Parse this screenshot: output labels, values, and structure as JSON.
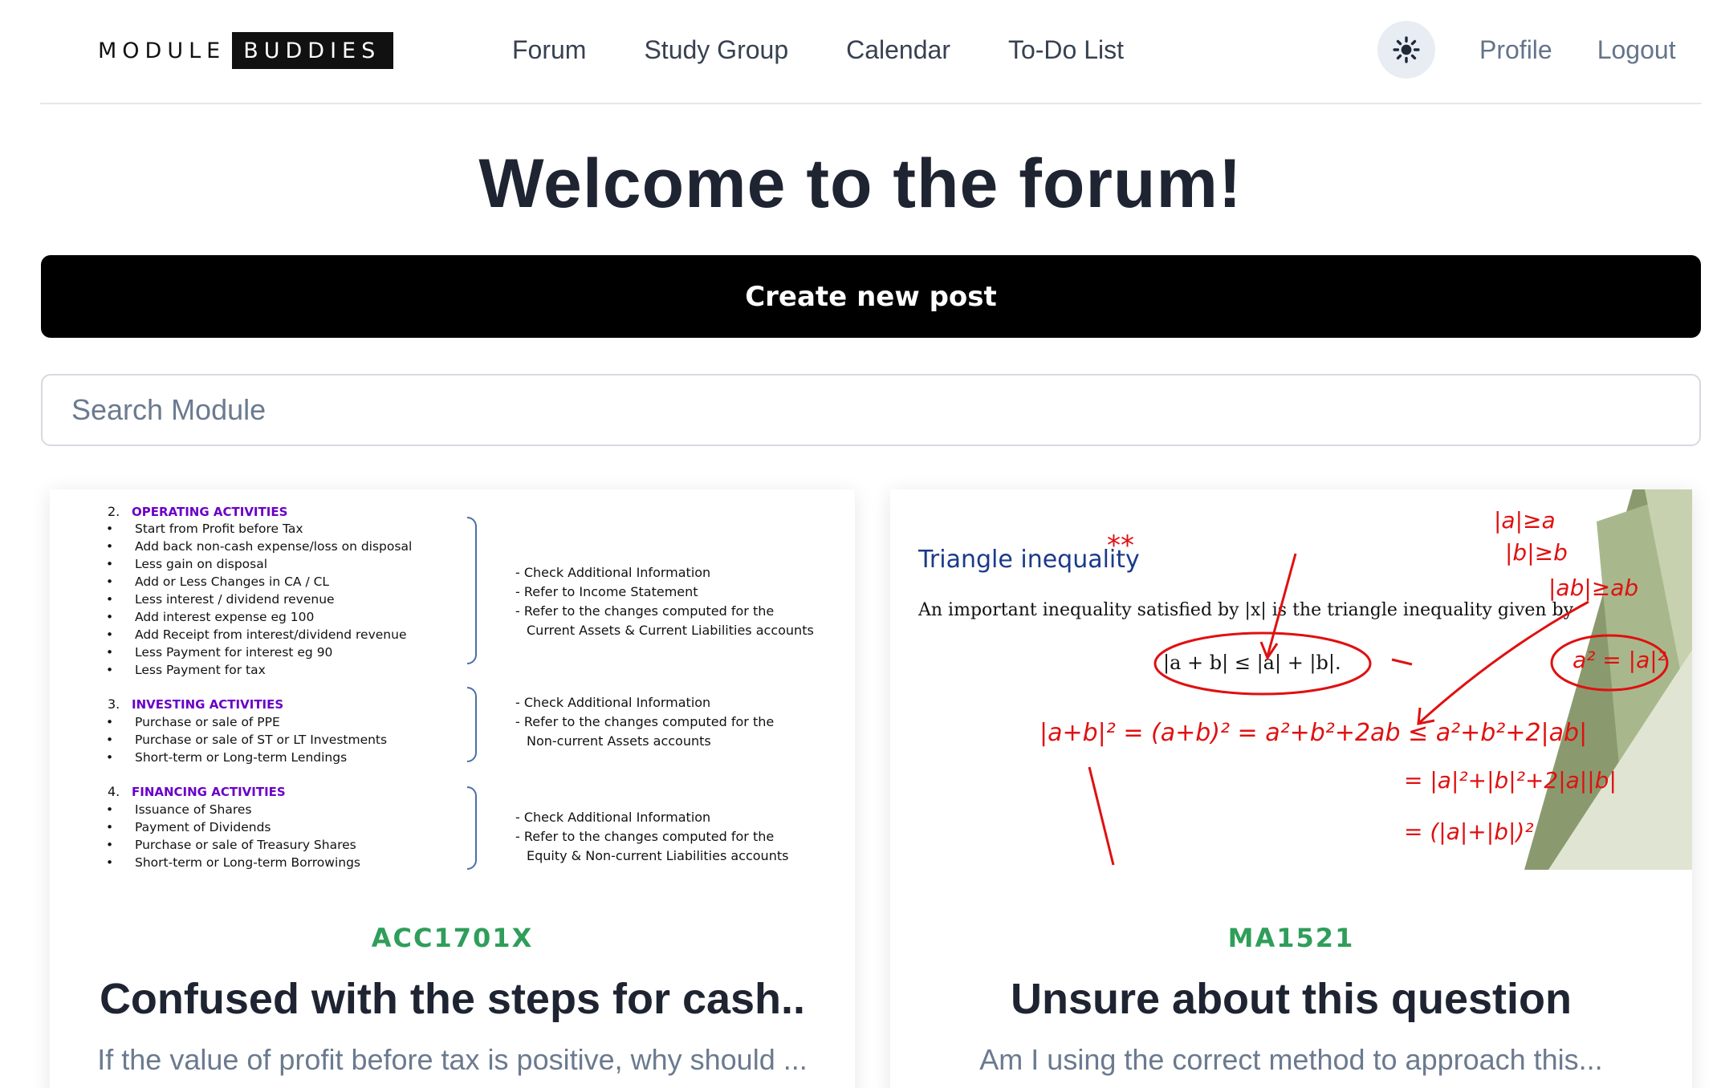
{
  "brand": {
    "part1": "MODULE",
    "part2": "BUDDIES"
  },
  "nav": [
    "Forum",
    "Study Group",
    "Calendar",
    "To-Do List"
  ],
  "header_right": {
    "theme_icon": "sun-icon",
    "profile": "Profile",
    "logout": "Logout"
  },
  "page_title": "Welcome to the forum!",
  "create_button": "Create new post",
  "search": {
    "placeholder": "Search Module",
    "value": ""
  },
  "posts": [
    {
      "module": "ACC1701X",
      "title": "Confused with the steps for cash..",
      "description": "If the value of profit before tax is positive, why should ...",
      "image": {
        "sections": [
          {
            "number": "2.",
            "heading": "OPERATING ACTIVITIES",
            "items": [
              "Start from Profit before Tax",
              "Add back non-cash expense/loss on disposal",
              "Less gain on disposal",
              "Add or Less Changes in CA / CL",
              "Less interest / dividend revenue",
              "Add interest expense eg 100",
              "Add Receipt from interest/dividend revenue",
              "Less Payment for interest eg 90",
              "Less Payment for tax"
            ],
            "notes": [
              "- Check Additional Information",
              "- Refer to Income Statement",
              "- Refer to the changes computed for the",
              "  Current Assets & Current Liabilities accounts"
            ]
          },
          {
            "number": "3.",
            "heading": "INVESTING ACTIVITIES",
            "items": [
              "Purchase or sale of PPE",
              "Purchase or sale of ST or LT Investments",
              "Short-term or Long-term Lendings"
            ],
            "notes": [
              "- Check Additional Information",
              "- Refer to the changes computed for the",
              "  Non-current Assets accounts"
            ]
          },
          {
            "number": "4.",
            "heading": "FINANCING ACTIVITIES",
            "items": [
              "Issuance of Shares",
              "Payment of Dividends",
              "Purchase or sale of Treasury Shares",
              "Short-term or Long-term Borrowings"
            ],
            "notes": [
              "- Check Additional Information",
              "- Refer to the changes computed for the",
              "  Equity & Non-current Liabilities accounts"
            ]
          }
        ]
      }
    },
    {
      "module": "MA1521",
      "title": "Unsure about this question",
      "description": "Am I using the correct method to approach this...",
      "image": {
        "heading": "Triangle inequality",
        "sentence": "An important inequality satisfied by |x| is the triangle inequality given by",
        "formula": "|a + b| ≤ |a| + |b|.",
        "annotations": [
          "**",
          "|a|≥a",
          "|b|≥b",
          "|ab|≥ab",
          "a² = |a|²",
          "|a+b|² = (a+b)² = a²+b²+2ab ≤ a²+b²+2|ab|",
          "= |a|²+|b|²+2|a||b|",
          "= (|a|+|b|)²"
        ]
      }
    }
  ]
}
